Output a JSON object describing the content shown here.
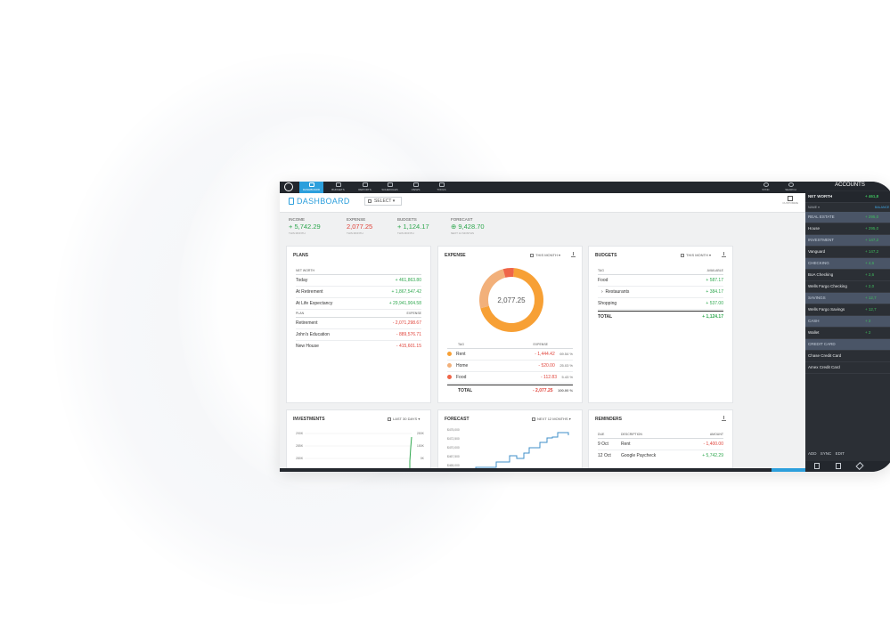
{
  "nav": {
    "items": [
      {
        "label": "DASHBOARD",
        "active": true
      },
      {
        "label": "BUDGETS",
        "active": false
      },
      {
        "label": "REPORTS",
        "active": false
      },
      {
        "label": "SCHEDULES",
        "active": false
      },
      {
        "label": "VIEWS",
        "active": false
      },
      {
        "label": "TOOLS",
        "active": false
      }
    ],
    "right_items": [
      "SYNC",
      "SEARCH"
    ]
  },
  "header": {
    "title": "DASHBOARD",
    "select_label": "SELECT",
    "customize_label": "CUSTOMIZE"
  },
  "summary": [
    {
      "label": "INCOME",
      "value": "+ 5,742.29",
      "sub": "THIS MONTH",
      "color": "#2fa84f"
    },
    {
      "label": "EXPENSE",
      "value": "2,077.25",
      "sub": "THIS MONTH",
      "color": "#e0433a"
    },
    {
      "label": "BUDGETS",
      "value": "+ 1,124.17",
      "sub": "THIS MONTH",
      "color": "#2fa84f"
    },
    {
      "label": "FORECAST",
      "value": "9,428.70",
      "sub": "NEXT 12 MONTHS",
      "color": "#2fa84f"
    }
  ],
  "plans": {
    "title": "PLANS",
    "networth_header": "NET WORTH",
    "networth_rows": [
      {
        "label": "Today",
        "value": "+ 461,863.80"
      },
      {
        "label": "At Retirement",
        "value": "+ 1,867,547.42"
      },
      {
        "label": "At Life Expectancy",
        "value": "+ 29,941,904.58"
      }
    ],
    "plan_header": "PLAN",
    "expense_header": "EXPENSE",
    "plan_rows": [
      {
        "label": "Retirement",
        "value": "- 2,071,298.67"
      },
      {
        "label": "John's Education",
        "value": "- 889,576.71"
      },
      {
        "label": "New House",
        "value": "- 415,601.15"
      }
    ]
  },
  "expense": {
    "title": "EXPENSE",
    "period": "THIS MONTH",
    "donut_center": "2,077.25",
    "tag_header": "TAG",
    "expense_header": "EXPENSE",
    "rows": [
      {
        "tag": "Rent",
        "value": "- 1,444.42",
        "pct": "69.54 %",
        "color": "#f7a035"
      },
      {
        "tag": "Home",
        "value": "- 520.00",
        "pct": "25.03 %",
        "color": "#f2b07a"
      },
      {
        "tag": "Food",
        "value": "- 112.83",
        "pct": "5.43 %",
        "color": "#ef6548"
      }
    ],
    "total_label": "TOTAL",
    "total_value": "- 2,077.25",
    "total_pct": "100.00 %"
  },
  "budgets": {
    "title": "BUDGETS",
    "period": "THIS MONTH",
    "tag_header": "TAG",
    "available_header": "AVAILABLE",
    "rows": [
      {
        "label": "Food",
        "value": "+ 587.17"
      },
      {
        "label": "Restaurants",
        "value": "+ 384.17"
      },
      {
        "label": "Shopping",
        "value": "+ 537.00"
      }
    ],
    "total_label": "TOTAL",
    "total_value": "+ 1,124.17"
  },
  "investments": {
    "title": "INVESTMENTS",
    "period": "LAST 30 DAYS",
    "yticks": [
      "290K",
      "285K",
      "280K"
    ],
    "yticks_right": [
      "280K",
      "180K",
      "0K"
    ]
  },
  "forecast": {
    "title": "FORECAST",
    "period": "NEXT 12 MONTHS",
    "yticks": [
      "$475,000",
      "$472,500",
      "$470,000",
      "$467,500",
      "$465,000"
    ]
  },
  "reminders": {
    "title": "REMINDERS",
    "headers": [
      "DUE",
      "DESCRIPTION",
      "AMOUNT"
    ],
    "rows": [
      {
        "due": "9 Oct",
        "desc": "Rent",
        "amount": "- 1,400.00"
      },
      {
        "due": "12 Oct",
        "desc": "Google Paycheck",
        "amount": "+ 5,742.29"
      }
    ]
  },
  "accounts": {
    "title": "ACCOUNTS",
    "net_worth_label": "NET WORTH",
    "net_worth_value": "+ 461,8",
    "sub_label": "NAME",
    "sub_value": "BALANCE",
    "rows": [
      {
        "label": "REAL ESTATE",
        "value": "+ 295,0",
        "group": true
      },
      {
        "label": "House",
        "value": "+ 295,0",
        "group": false
      },
      {
        "label": "INVESTMENT",
        "value": "+ 147,2",
        "group": true
      },
      {
        "label": "Vanguard",
        "value": "+ 147,2",
        "group": false
      },
      {
        "label": "CHECKING",
        "value": "+ 4,6",
        "group": true
      },
      {
        "label": "BoA Checking",
        "value": "+ 2,6",
        "group": false
      },
      {
        "label": "Wells Fargo Checking",
        "value": "+ 2,0",
        "group": false
      },
      {
        "label": "SAVINGS",
        "value": "+ 12,7",
        "group": true
      },
      {
        "label": "Wells Fargo Savings",
        "value": "+ 12,7",
        "group": false
      },
      {
        "label": "CASH",
        "value": "+ 2",
        "group": true
      },
      {
        "label": "Wallet",
        "value": "+ 2",
        "group": false
      },
      {
        "label": "CREDIT CARD",
        "value": "",
        "group": true
      },
      {
        "label": "Chase Credit Card",
        "value": "",
        "group": false
      },
      {
        "label": "Amex Credit Card",
        "value": "",
        "group": false
      }
    ],
    "bottom": [
      "ADD",
      "SYNC",
      "EDIT"
    ]
  },
  "colors": {
    "accent": "#2c9fdc",
    "positive": "#2fa84f",
    "negative": "#e0433a",
    "sidebar": "#2b2f35",
    "group": "#4a5567"
  }
}
